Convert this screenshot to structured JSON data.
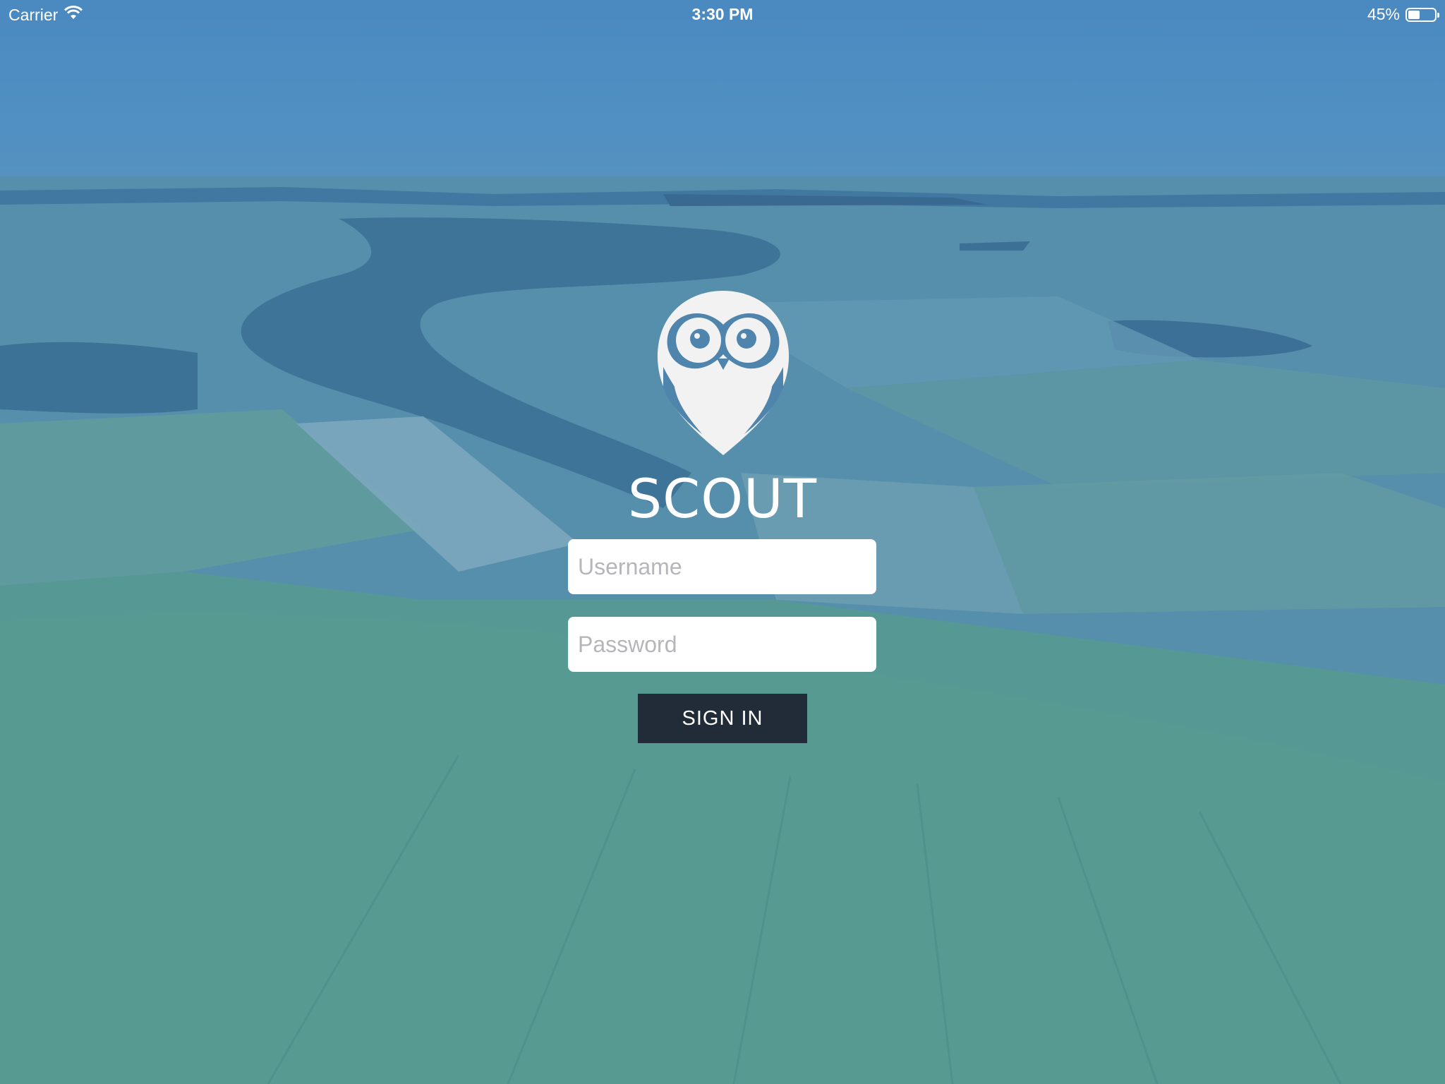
{
  "status_bar": {
    "carrier": "Carrier",
    "time": "3:30 PM",
    "battery_percent": "45%",
    "battery_level": 0.45,
    "wifi_icon": "wifi-icon",
    "battery_icon": "battery-icon"
  },
  "app": {
    "title": "SCOUT",
    "logo_icon": "owl-logo-icon"
  },
  "login": {
    "username_placeholder": "Username",
    "username_value": "",
    "password_placeholder": "Password",
    "password_value": "",
    "sign_in_label": "SIGN IN"
  },
  "colors": {
    "overlay": "#4f8ab8",
    "button_bg": "#222b38",
    "field_bg": "#ffffff",
    "owl": "#f2f2f2"
  }
}
